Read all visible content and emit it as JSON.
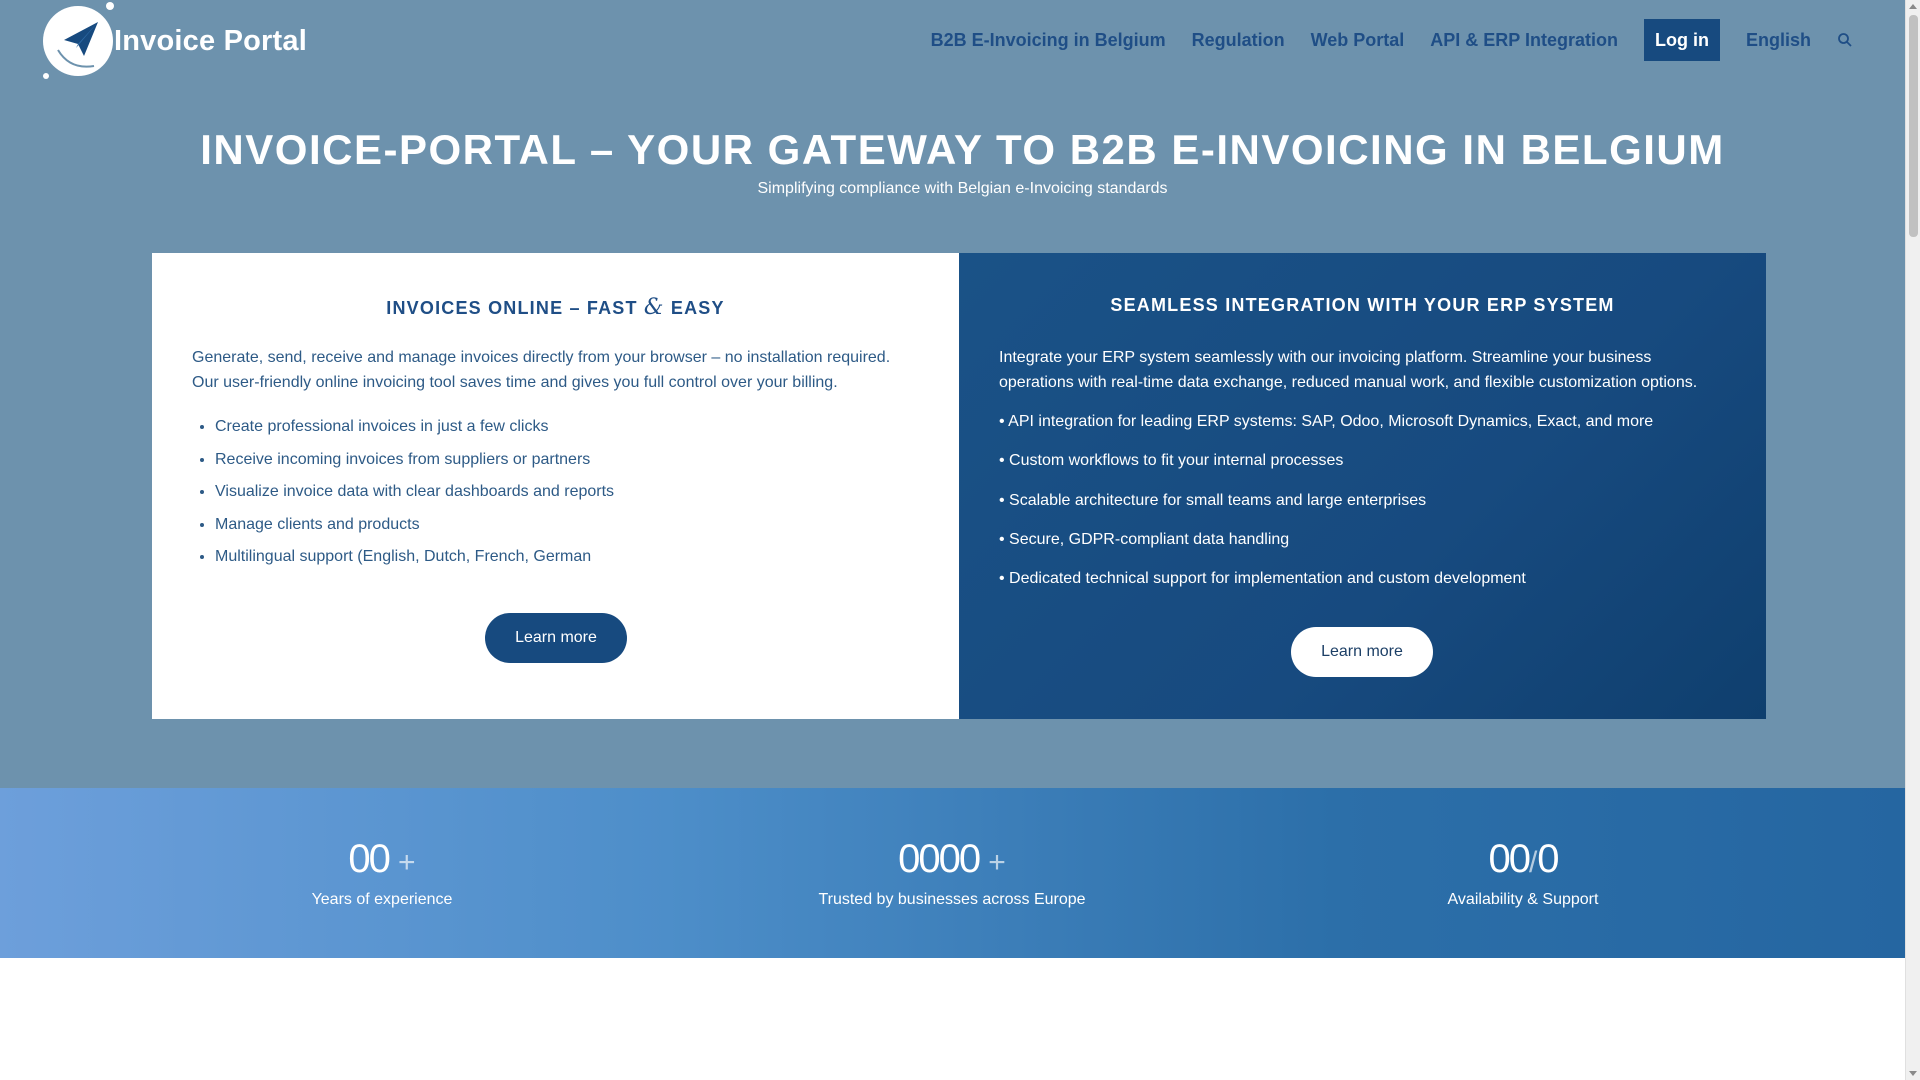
{
  "header": {
    "logo_text": "Invoice Portal",
    "nav": [
      "B2B E-Invoicing in Belgium",
      "Regulation",
      "Web Portal",
      "API & ERP Integration"
    ],
    "login_label": "Log in",
    "language": "English",
    "search_icon": "search-icon"
  },
  "hero": {
    "title": "INVOICE-PORTAL – YOUR GATEWAY TO B2B E-INVOICING IN BELGIUM",
    "subtitle": "Simplifying compliance with Belgian e-Invoicing standards"
  },
  "card_left": {
    "title_part1": "INVOICES ONLINE – FAST ",
    "title_amp": "&",
    "title_part2": " EASY",
    "text": "Generate, send, receive and manage invoices directly from your browser – no installation required. Our user-friendly online invoicing tool saves time and gives you full control over your billing.",
    "items": [
      "Create professional invoices in just a few clicks",
      "Receive incoming invoices from suppliers or partners",
      "Visualize invoice data with clear dashboards and reports",
      "Manage clients and products",
      "Multilingual support (English, Dutch, French, German"
    ],
    "button": "Learn more"
  },
  "card_right": {
    "title": "SEAMLESS INTEGRATION WITH YOUR ERP SYSTEM",
    "text": "Integrate your ERP system seamlessly with our invoicing platform. Streamline your business operations with real-time data exchange, reduced manual work, and flexible customization options.",
    "items": [
      "• API integration for leading ERP systems: SAP, Odoo, Microsoft Dynamics, Exact, and more",
      "• Custom workflows to fit your internal processes",
      "• Scalable architecture for small teams and large enterprises",
      "• Secure, GDPR-compliant data handling",
      "• Dedicated technical support for implementation and custom development"
    ],
    "button": "Learn more"
  },
  "stats": [
    {
      "number": "00",
      "suffix": "+",
      "label": "Years of experience"
    },
    {
      "number": "0000",
      "suffix": "+",
      "label": "Trusted by businesses across Europe"
    },
    {
      "number": "00",
      "mid": "/",
      "number2": "0",
      "label": "Availability & Support"
    }
  ],
  "colors": {
    "hero_bg": "#6d92ad",
    "brand_dark": "#174a7f",
    "nav_text": "#1f4e86"
  }
}
